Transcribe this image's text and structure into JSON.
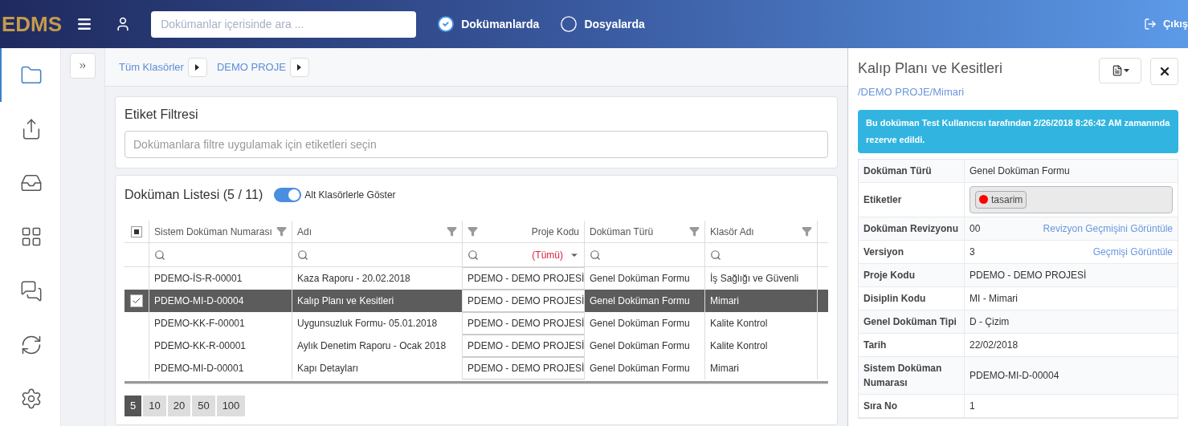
{
  "header": {
    "logo": "EDMS",
    "search": {
      "placeholder": "Dokümanlar içerisinde ara ..."
    },
    "scopes": [
      {
        "label": "Dokümanlarda",
        "selected": true
      },
      {
        "label": "Dosyalarda",
        "selected": false
      }
    ],
    "logout": "Çıkış"
  },
  "sidebar": {
    "items": [
      {
        "selected": true
      },
      {
        "selected": false
      },
      {
        "selected": false
      },
      {
        "selected": false
      },
      {
        "selected": false
      },
      {
        "selected": false
      },
      {
        "selected": false
      }
    ]
  },
  "breadcrumb": [
    "Tüm Klasörler",
    "DEMO PROJE"
  ],
  "tag_filter": {
    "title": "Etiket Filtresi",
    "placeholder": "Dokümanlara filtre uygulamak için etiketleri seçin"
  },
  "document_list": {
    "title": "Doküman Listesi (5 / 11)",
    "toggle": {
      "label": "Alt Klasörlerle Göster",
      "on": true
    },
    "select_all_partial": true,
    "columns": [
      "Sistem Doküman Numarası",
      "Adı",
      "Proje Kodu",
      "Doküman Türü",
      "Klasör Adı"
    ],
    "project_filter": "(Tümü)",
    "rows": [
      {
        "selected": false,
        "cells": [
          "PDEMO-İS-R-00001",
          "Kaza Raporu - 20.02.2018",
          "PDEMO - DEMO PROJESİ",
          "Genel Doküman Formu",
          "İş Sağlığı ve Güvenli"
        ]
      },
      {
        "selected": true,
        "cells": [
          "PDEMO-MI-D-00004",
          "Kalıp Planı ve Kesitleri",
          "PDEMO - DEMO PROJESİ",
          "Genel Doküman Formu",
          "Mimari"
        ]
      },
      {
        "selected": false,
        "cells": [
          "PDEMO-KK-F-00001",
          "Uygunsuzluk Formu- 05.01.2018",
          "PDEMO - DEMO PROJESİ",
          "Genel Doküman Formu",
          "Kalite Kontrol"
        ]
      },
      {
        "selected": false,
        "cells": [
          "PDEMO-KK-R-00001",
          "Aylık Denetim Raporu - Ocak 2018",
          "PDEMO - DEMO PROJESİ",
          "Genel Doküman Formu",
          "Kalite Kontrol"
        ]
      },
      {
        "selected": false,
        "cells": [
          "PDEMO-MI-D-00001",
          "Kapı Detayları",
          "PDEMO - DEMO PROJESİ",
          "Genel Doküman Formu",
          "Mimari"
        ]
      }
    ],
    "page_sizes": [
      {
        "label": "5",
        "selected": true
      },
      {
        "label": "10",
        "selected": false
      },
      {
        "label": "20",
        "selected": false
      },
      {
        "label": "50",
        "selected": false
      },
      {
        "label": "100",
        "selected": false
      }
    ]
  },
  "detail": {
    "title": "Kalıp Planı ve Kesitleri",
    "path": "/DEMO PROJE/Mimari",
    "alert": "Bu doküman Test Kullanıcısı tarafından 2/26/2018 8:26:42 AM zamanında rezerve edildi.",
    "fields": [
      {
        "kind": "text",
        "label": "Doküman Türü",
        "value": "Genel Doküman Formu"
      },
      {
        "kind": "tags",
        "label": "Etiketler",
        "tags": [
          {
            "label": "tasarim",
            "color": "#ff0000"
          }
        ]
      },
      {
        "kind": "text",
        "label": "Doküman Revizyonu",
        "value": "00",
        "link": "Revizyon Geçmişini Görüntüle"
      },
      {
        "kind": "text",
        "label": "Versiyon",
        "value": "3",
        "link": "Geçmişi Görüntüle"
      },
      {
        "kind": "text",
        "label": "Proje Kodu",
        "value": "PDEMO - DEMO PROJESİ"
      },
      {
        "kind": "text",
        "label": "Disiplin Kodu",
        "value": "MI - Mimari"
      },
      {
        "kind": "text",
        "label": "Genel Doküman Tipi",
        "value": "D - Çizim"
      },
      {
        "kind": "text",
        "label": "Tarih",
        "value": "22/02/2018"
      },
      {
        "kind": "text",
        "label": "Sistem Doküman Numarası",
        "value": "PDEMO-MI-D-00004"
      },
      {
        "kind": "text",
        "label": "Sıra No",
        "value": "1"
      }
    ]
  }
}
